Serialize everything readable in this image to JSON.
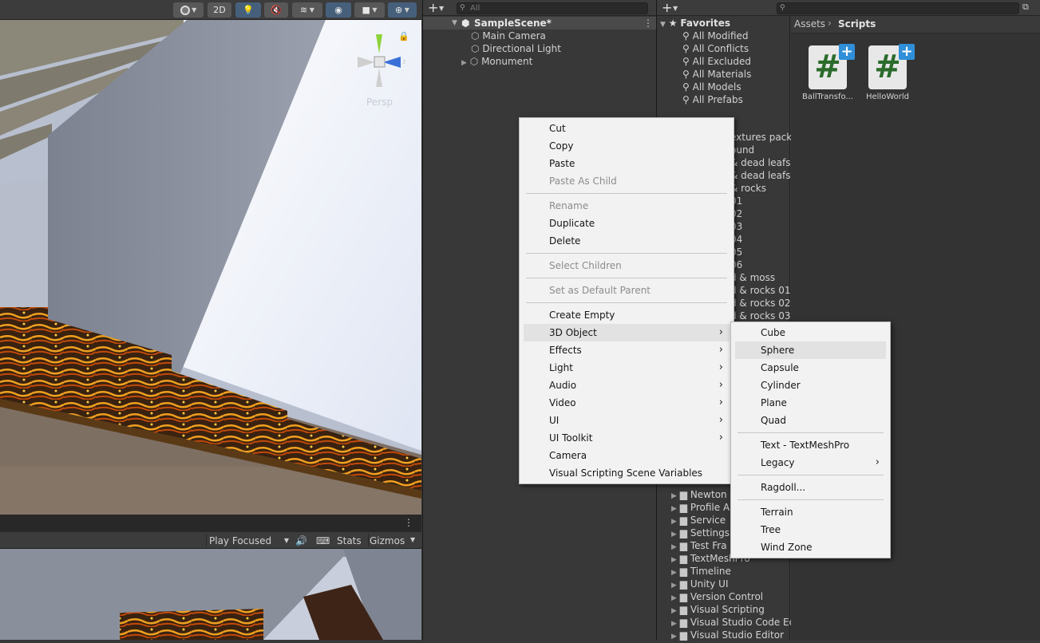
{
  "scene_view": {
    "toolbar": {
      "mode_2d": "2D"
    },
    "gizmo": {
      "projection_label": "Persp"
    }
  },
  "game_view": {
    "play_mode": "Play Focused",
    "stats": "Stats",
    "gizmos": "Gizmos"
  },
  "hierarchy": {
    "search_placeholder": "All",
    "scene_name": "SampleScene*",
    "items": [
      "Main Camera",
      "Directional Light",
      "Monument"
    ]
  },
  "project": {
    "search_placeholder": "",
    "favorites": {
      "title": "Favorites",
      "items": [
        "All Modified",
        "All Conflicts",
        "All Excluded",
        "All Materials",
        "All Models",
        "All Prefabs"
      ]
    },
    "partial_items": [
      "extures pack",
      "ound",
      "& dead leafs",
      "& dead leafs",
      "& rocks",
      "01",
      "02",
      "03",
      "04",
      "05",
      "06",
      "d & moss",
      "d & rocks 01",
      "d & rocks 02",
      "d & rocks 03"
    ],
    "folders": [
      "Newton",
      "Profile A",
      "Service",
      "Settings",
      "Test Fra",
      "TextMeshPro",
      "Timeline",
      "Unity UI",
      "Version Control",
      "Visual Scripting",
      "Visual Studio Code Ed",
      "Visual Studio Editor"
    ],
    "breadcrumb": {
      "root": "Assets",
      "current": "Scripts"
    },
    "assets": [
      {
        "name": "BallTransfo...",
        "icon": "csharp-script-icon"
      },
      {
        "name": "HelloWorld",
        "icon": "csharp-script-icon"
      }
    ]
  },
  "context_menu": {
    "items": {
      "cut": "Cut",
      "copy": "Copy",
      "paste": "Paste",
      "paste_as_child": "Paste As Child",
      "rename": "Rename",
      "duplicate": "Duplicate",
      "delete": "Delete",
      "select_children": "Select Children",
      "set_default_parent": "Set as Default Parent",
      "create_empty": "Create Empty",
      "object_3d": "3D Object",
      "effects": "Effects",
      "light": "Light",
      "audio": "Audio",
      "video": "Video",
      "ui": "UI",
      "ui_toolkit": "UI Toolkit",
      "camera": "Camera",
      "vs_scene_variables": "Visual Scripting Scene Variables"
    }
  },
  "submenu_3d": {
    "items": {
      "cube": "Cube",
      "sphere": "Sphere",
      "capsule": "Capsule",
      "cylinder": "Cylinder",
      "plane": "Plane",
      "quad": "Quad",
      "text_tmp": "Text - TextMeshPro",
      "legacy": "Legacy",
      "ragdoll": "Ragdoll...",
      "terrain": "Terrain",
      "tree": "Tree",
      "wind_zone": "Wind Zone"
    }
  },
  "colors": {
    "panel_bg": "#383838",
    "toolbar_bg": "#3c3c3c",
    "menu_bg": "#f2f2f2",
    "menu_highlight": "#e2e2e2",
    "accent_blue": "#46607c",
    "csharp_green": "#2b6b2b",
    "plus_badge": "#2f8fd8"
  }
}
